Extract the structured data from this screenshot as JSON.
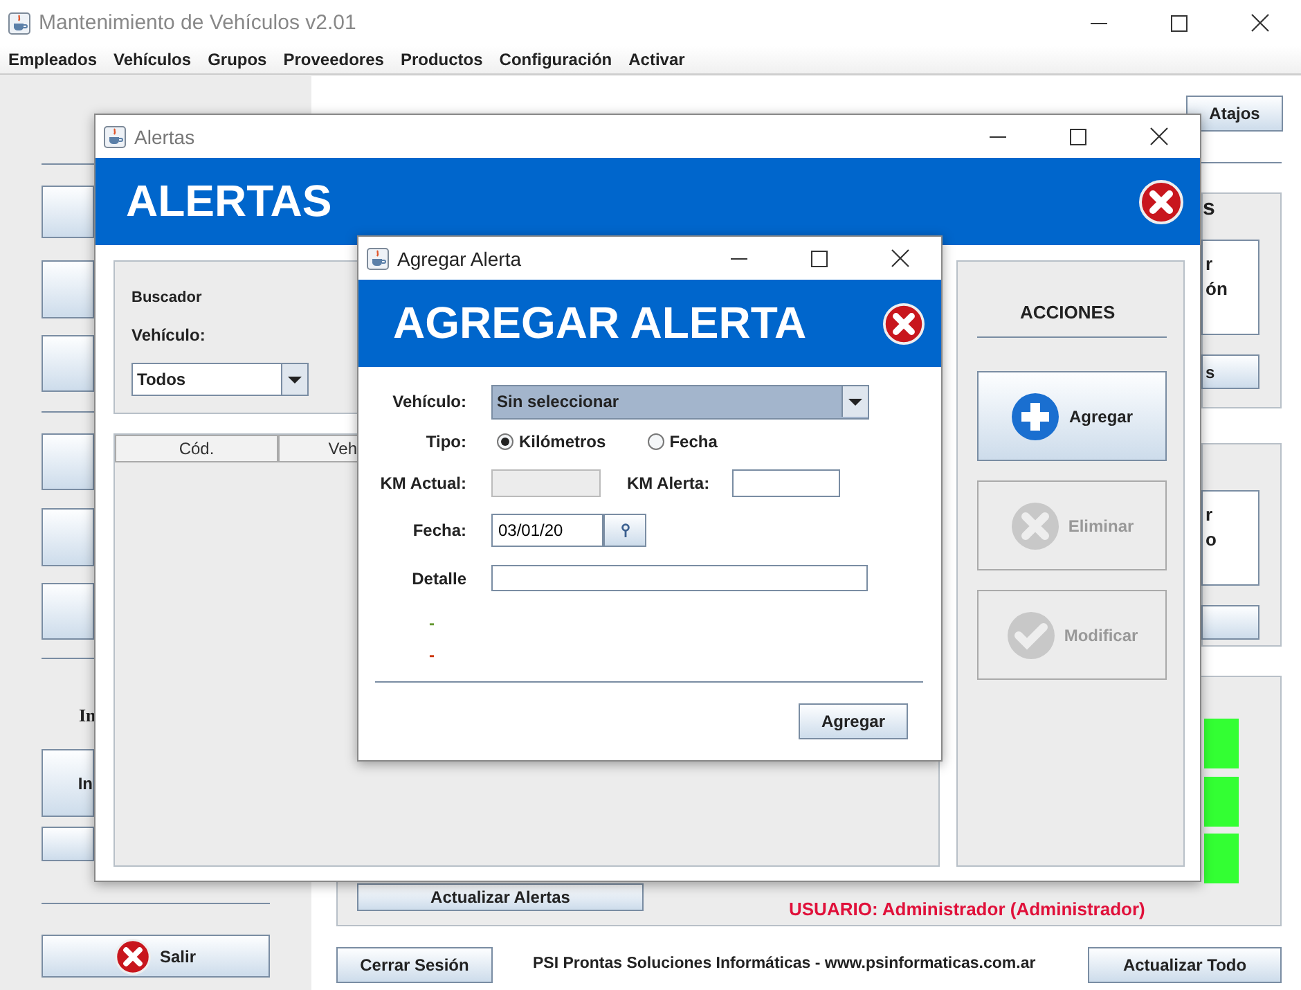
{
  "main_window": {
    "title": "Mantenimiento de Vehículos v2.01",
    "menu": [
      "Empleados",
      "Vehículos",
      "Grupos",
      "Proveedores",
      "Productos",
      "Configuración",
      "Activar"
    ],
    "left_panel": {
      "section_label": "In",
      "section_button": "In",
      "exit_button": "Salir"
    },
    "shortcuts_button": "Atajos",
    "side_panels": [
      {
        "heading": "s",
        "card_lines": [
          "r",
          "ón"
        ],
        "button": "s"
      },
      {
        "card_lines": [
          "r",
          "o"
        ]
      }
    ],
    "refresh_alerts_button": "Actualizar Alertas",
    "user_label": "USUARIO: Administrador (Administrador)",
    "footer": {
      "logout_button": "Cerrar Sesión",
      "credits": "PSI Prontas Soluciones Informáticas - www.psinformaticas.com.ar",
      "refresh_all_button": "Actualizar Todo"
    }
  },
  "alerts_window": {
    "title": "Alertas",
    "header": "ALERTAS",
    "search": {
      "heading": "Buscador",
      "vehicle_label": "Vehículo:",
      "vehicle_value": "Todos"
    },
    "table": {
      "columns": [
        "Cód.",
        "Veh"
      ]
    },
    "actions": {
      "heading": "ACCIONES",
      "buttons": [
        {
          "label": "Agregar",
          "kind": "add",
          "disabled": false
        },
        {
          "label": "Eliminar",
          "kind": "delete",
          "disabled": true
        },
        {
          "label": "Modificar",
          "kind": "edit",
          "disabled": true
        }
      ]
    }
  },
  "add_dialog": {
    "title": "Agregar Alerta",
    "header": "AGREGAR ALERTA",
    "vehicle": {
      "label": "Vehículo:",
      "value": "Sin seleccionar"
    },
    "type": {
      "label": "Tipo:",
      "options": [
        {
          "label": "Kilómetros",
          "selected": true
        },
        {
          "label": "Fecha",
          "selected": false
        }
      ]
    },
    "km_current": {
      "label": "KM Actual:",
      "disabled": true
    },
    "km_alert": {
      "label": "KM Alerta:"
    },
    "date": {
      "label": "Fecha:",
      "value": "03/01/20"
    },
    "detail": {
      "label": "Detalle"
    },
    "messages": [
      {
        "text": "-",
        "color": "#669933"
      },
      {
        "text": "-",
        "color": "#cc3300"
      }
    ],
    "submit_button": "Agregar"
  }
}
